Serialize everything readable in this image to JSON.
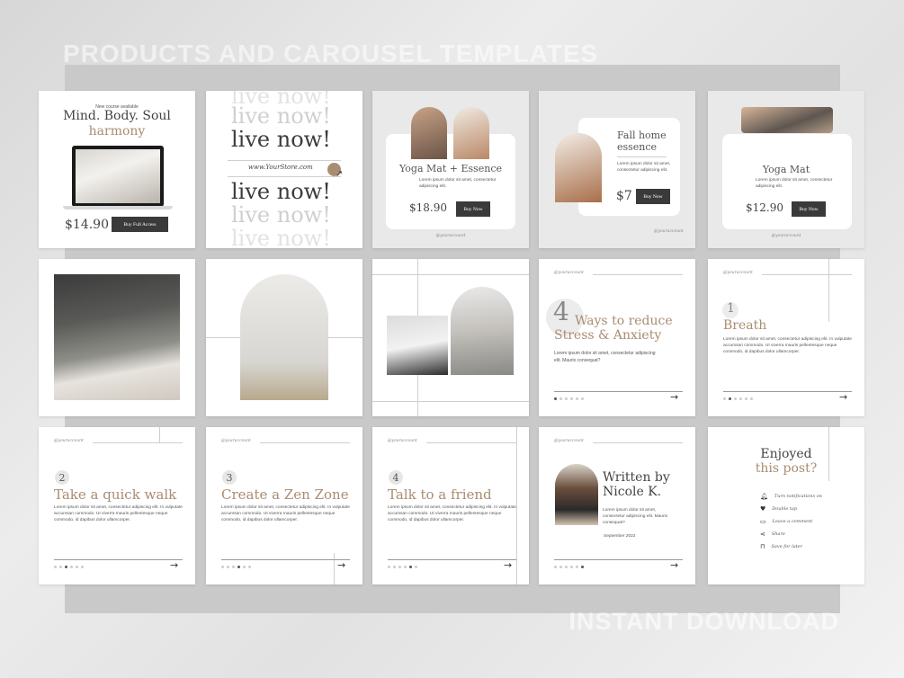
{
  "header": "PRODUCTS AND CAROUSEL TEMPLATES",
  "footer": "INSTANT DOWNLOAD",
  "c1": {
    "tag": "New course available",
    "title": "Mind. Body. Soul",
    "accent": "harmony",
    "price": "$14.90",
    "button": "Buy Full Access"
  },
  "c2": {
    "repeat": "live now!",
    "url": "www.YourStore.com"
  },
  "c3": {
    "title": "Yoga Mat + Essence",
    "desc": "Lorem ipsum dolor sit amet, consectetur adipiscing elit.",
    "price": "$18.90",
    "button": "Buy Now",
    "handle": "@youraccount"
  },
  "c4": {
    "title1": "Fall home",
    "title2": "essence",
    "desc": "Lorem ipsum dolor sit amet, consectetur adipiscing elit.",
    "price": "$7",
    "button": "Buy Now",
    "handle": "@youraccount"
  },
  "c5": {
    "title": "Yoga Mat",
    "desc": "Lorem ipsum dolor sit amet, consectetur adipiscing elit.",
    "price": "$12.90",
    "button": "Buy Now",
    "handle": "@youraccount"
  },
  "c9": {
    "handle": "@youraccount",
    "num": "4",
    "line1": "Ways to reduce",
    "line2": "Stress & Anxiety",
    "desc": "Lorem ipsum dolor sit amet, consectetur adipiscing elit. Mauris consequat?"
  },
  "c10": {
    "handle": "@youraccount",
    "num": "1",
    "title": "Breath",
    "desc": "Lorem ipsum dolor sit amet, consectetur adipiscing elit. In vulputate accumsan commodo. Ut viverra mauris pellentesque neque commodo, id dapibus dolor ullamcorper."
  },
  "c11": {
    "handle": "@youraccount",
    "num": "2",
    "title": "Take a quick walk",
    "desc": "Lorem ipsum dolor sit amet, consectetur adipiscing elit. In vulputate accumsan commodo. Ut viverra mauris pellentesque neque commodo, id dapibus dolor ullamcorper."
  },
  "c12": {
    "handle": "@youraccount",
    "num": "3",
    "title": "Create a Zen Zone",
    "desc": "Lorem ipsum dolor sit amet, consectetur adipiscing elit. In vulputate accumsan commodo. Ut viverra mauris pellentesque neque commodo, id dapibus dolor ullamcorper."
  },
  "c13": {
    "handle": "@youraccount",
    "num": "4",
    "title": "Talk to a friend",
    "desc": "Lorem ipsum dolor sit amet, consectetur adipiscing elit. In vulputate accumsan commodo. Ut viverra mauris pellentesque neque commodo, id dapibus dolor ullamcorper."
  },
  "c14": {
    "handle": "@youraccount",
    "line1": "Written by",
    "line2": "Nicole K.",
    "desc": "Lorem ipsum dolor sit amet, consectetur adipiscing elit. Mauris consequat?",
    "date": "September 2022"
  },
  "c15": {
    "line1": "Enjoyed",
    "line2": "this post?",
    "actions": [
      "Turn notifications on",
      "Double tap",
      "Leave a comment",
      "Share",
      "Save for later"
    ]
  },
  "colors": {
    "accent": "#a98d72",
    "button": "#3a3a3a",
    "card": "#ffffff",
    "grey_card": "#e9e9e9"
  }
}
